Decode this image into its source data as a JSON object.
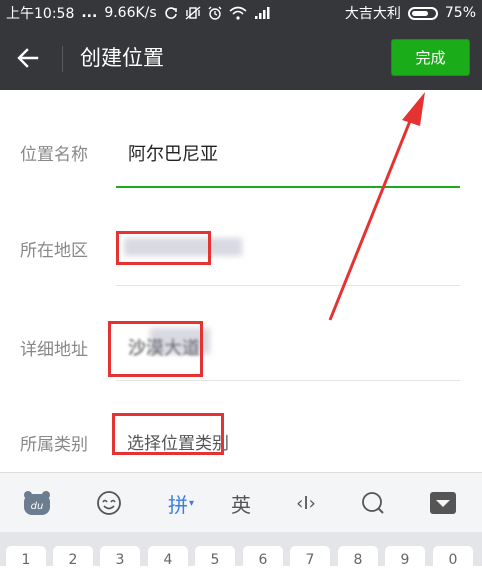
{
  "status_bar": {
    "time": "上午10:58",
    "dots": "...",
    "speed": "9.66K/s",
    "carrier": "大吉大利",
    "battery": "75%"
  },
  "header": {
    "title": "创建位置",
    "done_label": "完成"
  },
  "form": {
    "name_label": "位置名称",
    "name_value": "阿尔巴尼亚",
    "region_label": "所在地区",
    "address_label": "详细地址",
    "address_value": "沙漠大道",
    "category_label": "所属类别",
    "category_placeholder": "选择位置类别"
  },
  "keyboard": {
    "toolbar": {
      "pinyin": "拼",
      "english": "英",
      "cursor": "‹I›"
    },
    "number_keys": [
      "1",
      "2",
      "3",
      "4",
      "5",
      "6",
      "7",
      "8",
      "9",
      "0"
    ]
  },
  "colors": {
    "bar_bg": "#35373b",
    "accent_green": "#1aad19",
    "annotation_red": "#e53333"
  }
}
